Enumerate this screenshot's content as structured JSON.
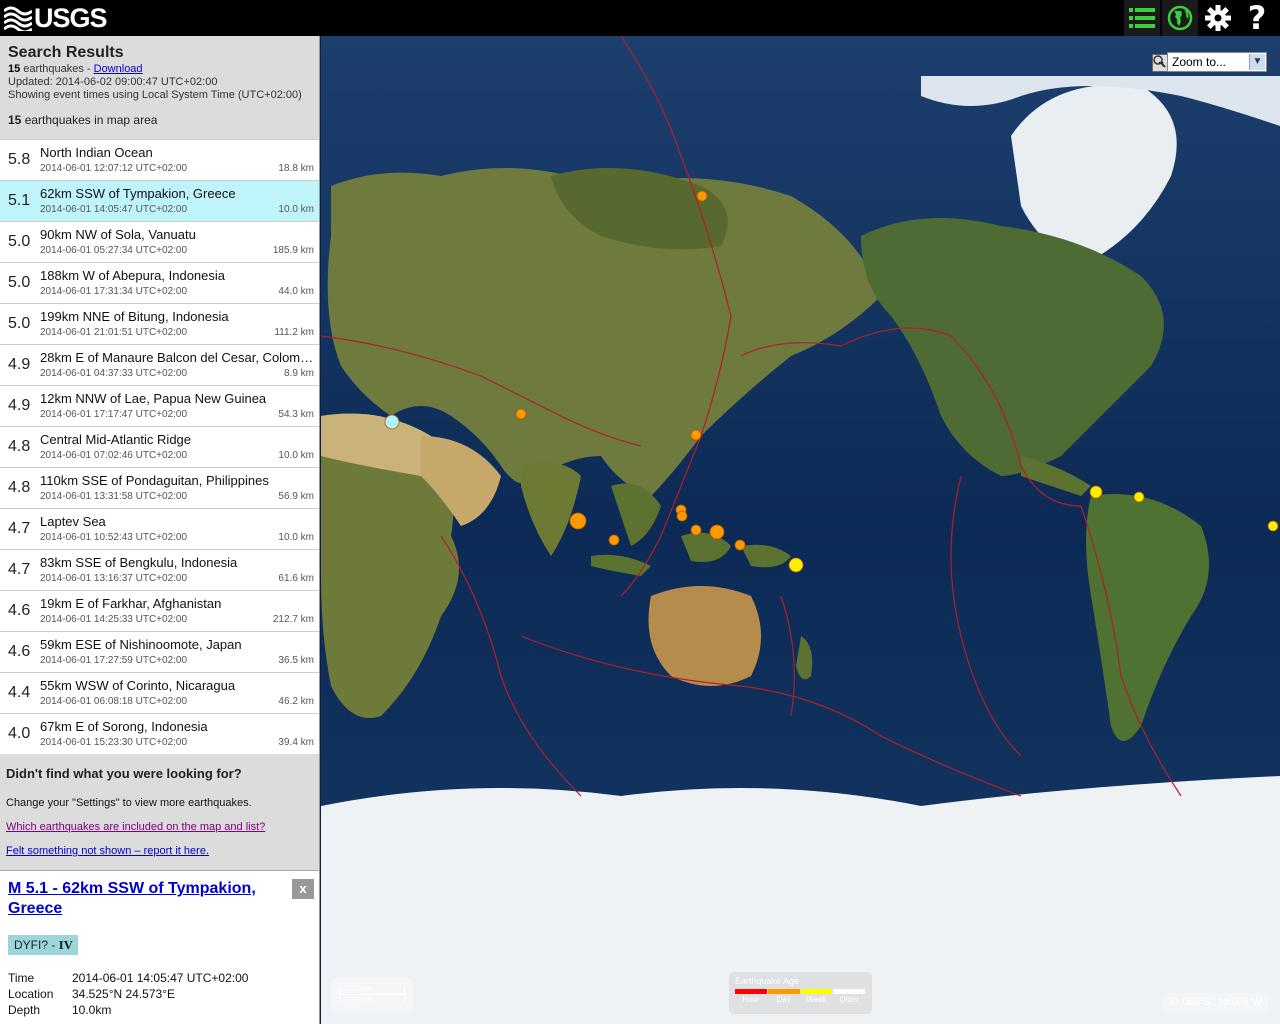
{
  "topbar": {
    "logo_text": "USGS",
    "icons": [
      "list-icon",
      "globe-icon",
      "gear-icon",
      "help-icon"
    ],
    "help_label": "?"
  },
  "colors": {
    "accent_green": "#3bd13b",
    "selected_row": "#c0f4fb",
    "link": "#0000cc"
  },
  "results": {
    "title": "Search Results",
    "count": "15",
    "count_suffix": " earthquakes - ",
    "download_label": "Download",
    "updated": "Updated: 2014-06-02 09:00:47 UTC+02:00",
    "timezone_note": "Showing event times using Local System Time (UTC+02:00)",
    "map_count": "15",
    "map_count_suffix": " earthquakes in map area"
  },
  "earthquakes": [
    {
      "mag": "5.8",
      "place": "North Indian Ocean",
      "time": "2014-06-01 12:07:12 UTC+02:00",
      "depth": "18.8 km"
    },
    {
      "mag": "5.1",
      "place": "62km SSW of Tympakion, Greece",
      "time": "2014-06-01 14:05:47 UTC+02:00",
      "depth": "10.0 km"
    },
    {
      "mag": "5.0",
      "place": "90km NW of Sola, Vanuatu",
      "time": "2014-06-01 05:27:34 UTC+02:00",
      "depth": "185.9 km"
    },
    {
      "mag": "5.0",
      "place": "188km W of Abepura, Indonesia",
      "time": "2014-06-01 17:31:34 UTC+02:00",
      "depth": "44.0 km"
    },
    {
      "mag": "5.0",
      "place": "199km NNE of Bitung, Indonesia",
      "time": "2014-06-01 21:01:51 UTC+02:00",
      "depth": "111.2 km"
    },
    {
      "mag": "4.9",
      "place": "28km E of Manaure Balcon del Cesar, Colombia",
      "time": "2014-06-01 04:37:33 UTC+02:00",
      "depth": "8.9 km"
    },
    {
      "mag": "4.9",
      "place": "12km NNW of Lae, Papua New Guinea",
      "time": "2014-06-01 17:17:47 UTC+02:00",
      "depth": "54.3 km"
    },
    {
      "mag": "4.8",
      "place": "Central Mid-Atlantic Ridge",
      "time": "2014-06-01 07:02:46 UTC+02:00",
      "depth": "10.0 km"
    },
    {
      "mag": "4.8",
      "place": "110km SSE of Pondaguitan, Philippines",
      "time": "2014-06-01 13:31:58 UTC+02:00",
      "depth": "56.9 km"
    },
    {
      "mag": "4.7",
      "place": "Laptev Sea",
      "time": "2014-06-01 10:52:43 UTC+02:00",
      "depth": "10.0 km"
    },
    {
      "mag": "4.7",
      "place": "83km SSE of Bengkulu, Indonesia",
      "time": "2014-06-01 13:16:37 UTC+02:00",
      "depth": "61.6 km"
    },
    {
      "mag": "4.6",
      "place": "19km E of Farkhar, Afghanistan",
      "time": "2014-06-01 14:25:33 UTC+02:00",
      "depth": "212.7 km"
    },
    {
      "mag": "4.6",
      "place": "59km ESE of Nishinoomote, Japan",
      "time": "2014-06-01 17:27:59 UTC+02:00",
      "depth": "36.5 km"
    },
    {
      "mag": "4.4",
      "place": "55km WSW of Corinto, Nicaragua",
      "time": "2014-06-01 06:08:18 UTC+02:00",
      "depth": "46.2 km"
    },
    {
      "mag": "4.0",
      "place": "67km E of Sorong, Indonesia",
      "time": "2014-06-01 15:23:30 UTC+02:00",
      "depth": "39.4 km"
    }
  ],
  "help": {
    "title": "Didn't find what you were looking for?",
    "text": "Change your \"Settings\" to view more earthquakes.",
    "link1": "Which earthquakes are included on the map and list?",
    "link2": "Felt something not shown – report it here."
  },
  "detail": {
    "title": "M 5.1 - 62km SSW of Tympakion, Greece",
    "close_label": "x",
    "dyfi_label": "DYFI? - ",
    "dyfi_value": "IV",
    "fields": [
      {
        "key": "Time",
        "value": "2014-06-01 14:05:47 UTC+02:00"
      },
      {
        "key": "Location",
        "value": "34.525°N 24.573°E"
      },
      {
        "key": "Depth",
        "value": "10.0km"
      }
    ]
  },
  "map": {
    "zoom_out": "-",
    "zoom_in": "+",
    "zoom_select": "Zoom to...",
    "scale_km": "3000 km",
    "scale_mi": "2000 mi",
    "legend_title": "Earthquake Age",
    "legend_items": [
      {
        "label": "Hour",
        "color": "#ff0000"
      },
      {
        "label": "Day",
        "color": "#ff9900"
      },
      {
        "label": "Week",
        "color": "#ffff00"
      },
      {
        "label": "Older",
        "color": "#ffffff"
      }
    ],
    "coordinates": "83.069°S : 23.906°W"
  }
}
